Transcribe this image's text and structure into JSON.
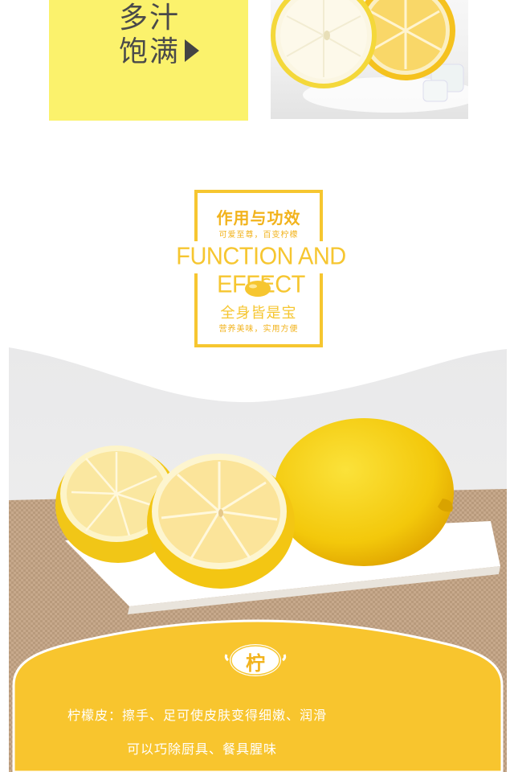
{
  "top": {
    "line1": "多汁",
    "line2": "饱满"
  },
  "section": {
    "title_cn": "作用与功效",
    "subtitle_cn": "可爱至尊，百变柠檬",
    "title_en": "FUNCTION AND EFFECT",
    "slogan": "全身皆是宝",
    "slogan_sub": "营养美味，实用方便"
  },
  "card": {
    "badge_char": "柠",
    "line1": "柠檬皮：擦手、足可使皮肤变得细嫩、润滑",
    "line2": "可以巧除厨具、餐具腥味"
  },
  "colors": {
    "accent_yellow": "#f6c630",
    "pale_yellow": "#fbf26c",
    "card_yellow": "#f8c52e"
  }
}
